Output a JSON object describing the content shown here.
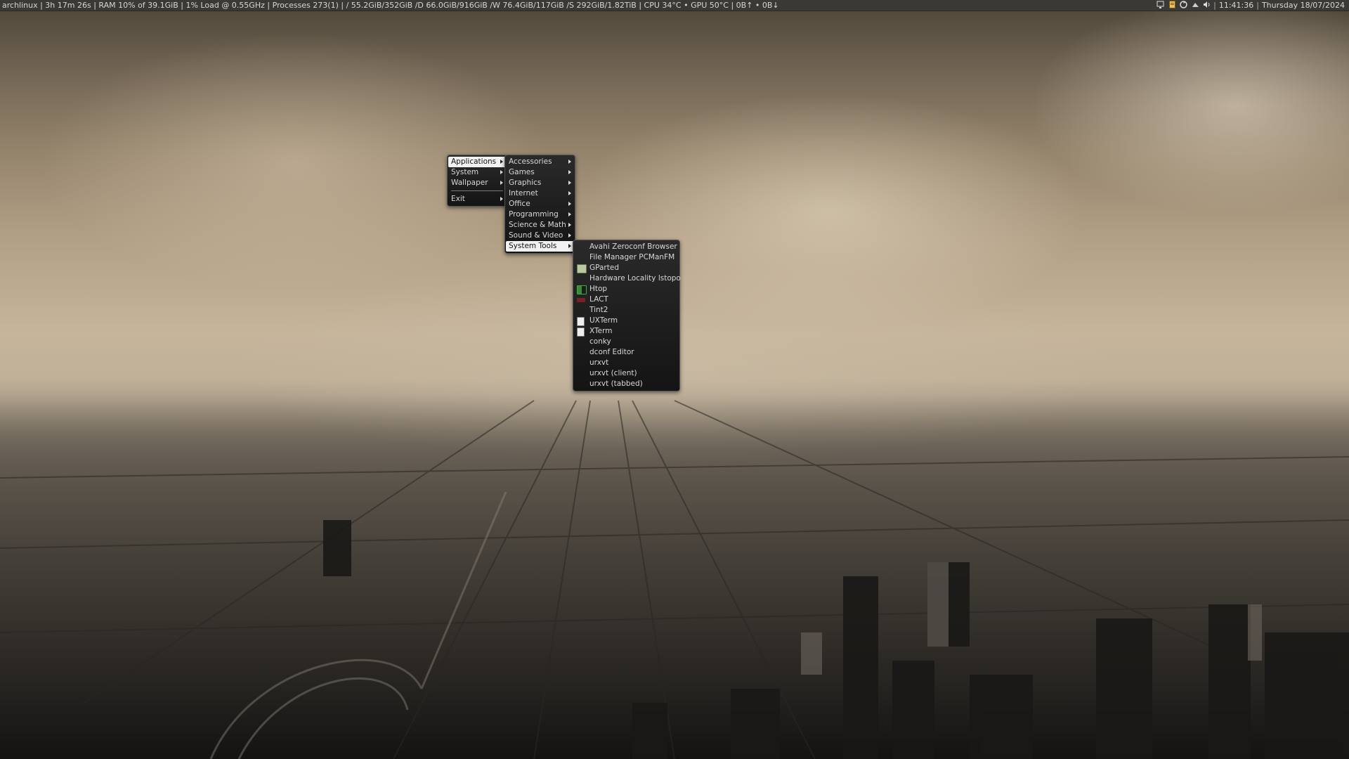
{
  "topbar": {
    "status_left": "archlinux  |  3h 17m 26s  |  RAM 10% of 39.1GiB  |  1% Load @ 0.55GHz  |  Processes 273(1)  |  / 55.2GiB/352GiB  /D 66.0GiB/916GiB  /W 76.4GiB/117GiB  /S 292GiB/1.82TiB  |  CPU 34°C • GPU 50°C  |  0B↑ • 0B↓",
    "time": "11:41:36",
    "date": "Thursday 18/07/2024",
    "tray_icons": [
      "monitor-icon",
      "file-icon",
      "update-icon",
      "network-icon",
      "volume-icon"
    ]
  },
  "root_menu": {
    "items": [
      {
        "label": "Applications",
        "has_submenu": true,
        "selected": true
      },
      {
        "label": "System",
        "has_submenu": true
      },
      {
        "label": "Wallpaper",
        "has_submenu": true
      },
      {
        "label": "Exit",
        "has_submenu": true
      }
    ]
  },
  "applications_menu": {
    "items": [
      {
        "label": "Accessories",
        "has_submenu": true
      },
      {
        "label": "Games",
        "has_submenu": true
      },
      {
        "label": "Graphics",
        "has_submenu": true
      },
      {
        "label": "Internet",
        "has_submenu": true
      },
      {
        "label": "Office",
        "has_submenu": true
      },
      {
        "label": "Programming",
        "has_submenu": true
      },
      {
        "label": "Science & Math",
        "has_submenu": true
      },
      {
        "label": "Sound & Video",
        "has_submenu": true
      },
      {
        "label": "System Tools",
        "has_submenu": true,
        "selected": true
      }
    ]
  },
  "system_tools_menu": {
    "items": [
      {
        "label": "Avahi Zeroconf Browser",
        "icon": ""
      },
      {
        "label": "File Manager PCManFM",
        "icon": ""
      },
      {
        "label": "GParted",
        "icon": "gparted-icon"
      },
      {
        "label": "Hardware Locality lstopo",
        "icon": ""
      },
      {
        "label": "Htop",
        "icon": "htop-icon"
      },
      {
        "label": "LACT",
        "icon": "lact-icon"
      },
      {
        "label": "Tint2",
        "icon": ""
      },
      {
        "label": "UXTerm",
        "icon": "terminal-icon"
      },
      {
        "label": "XTerm",
        "icon": "terminal-icon"
      },
      {
        "label": "conky",
        "icon": ""
      },
      {
        "label": "dconf Editor",
        "icon": ""
      },
      {
        "label": "urxvt",
        "icon": ""
      },
      {
        "label": "urxvt (client)",
        "icon": ""
      },
      {
        "label": "urxvt (tabbed)",
        "icon": ""
      }
    ]
  },
  "colors": {
    "topbar_bg": "#3b3935",
    "menu_bg": "#1c1c1c",
    "selected_bg": "#f2f2f2"
  }
}
